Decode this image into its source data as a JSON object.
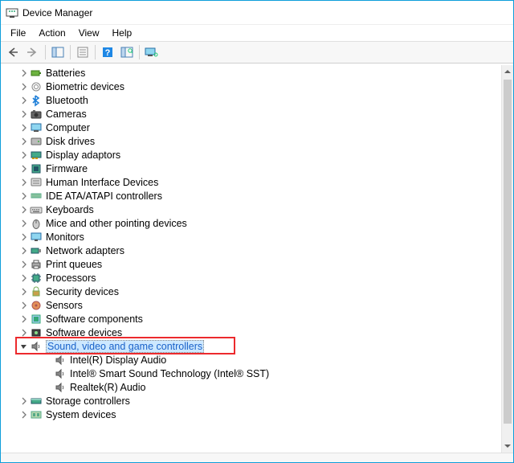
{
  "window": {
    "title": "Device Manager"
  },
  "menu": {
    "items": [
      "File",
      "Action",
      "View",
      "Help"
    ]
  },
  "toolbar": {
    "back_icon": "back-arrow-icon",
    "forward_icon": "forward-arrow-icon",
    "show_hide_icon": "show-hide-console-tree-icon",
    "properties_icon": "properties-icon",
    "help_icon": "help-icon",
    "scan_icon": "scan-hardware-changes-icon",
    "monitor_icon": "add-legacy-hardware-icon"
  },
  "tree": {
    "nodes": [
      {
        "label": "Batteries",
        "icon": "battery-icon",
        "expanded": false
      },
      {
        "label": "Biometric devices",
        "icon": "biometric-icon",
        "expanded": false
      },
      {
        "label": "Bluetooth",
        "icon": "bluetooth-icon",
        "expanded": false
      },
      {
        "label": "Cameras",
        "icon": "camera-icon",
        "expanded": false
      },
      {
        "label": "Computer",
        "icon": "computer-icon",
        "expanded": false
      },
      {
        "label": "Disk drives",
        "icon": "disk-drive-icon",
        "expanded": false
      },
      {
        "label": "Display adaptors",
        "icon": "display-adapter-icon",
        "expanded": false
      },
      {
        "label": "Firmware",
        "icon": "firmware-icon",
        "expanded": false
      },
      {
        "label": "Human Interface Devices",
        "icon": "hid-icon",
        "expanded": false
      },
      {
        "label": "IDE ATA/ATAPI controllers",
        "icon": "ide-controller-icon",
        "expanded": false
      },
      {
        "label": "Keyboards",
        "icon": "keyboard-icon",
        "expanded": false
      },
      {
        "label": "Mice and other pointing devices",
        "icon": "mouse-icon",
        "expanded": false
      },
      {
        "label": "Monitors",
        "icon": "monitor-icon",
        "expanded": false
      },
      {
        "label": "Network adapters",
        "icon": "network-adapter-icon",
        "expanded": false
      },
      {
        "label": "Print queues",
        "icon": "printer-icon",
        "expanded": false
      },
      {
        "label": "Processors",
        "icon": "processor-icon",
        "expanded": false
      },
      {
        "label": "Security devices",
        "icon": "security-device-icon",
        "expanded": false
      },
      {
        "label": "Sensors",
        "icon": "sensor-icon",
        "expanded": false
      },
      {
        "label": "Software components",
        "icon": "software-component-icon",
        "expanded": false
      },
      {
        "label": "Software devices",
        "icon": "software-device-icon",
        "expanded": false
      },
      {
        "label": "Sound, video and game controllers",
        "icon": "sound-controller-icon",
        "expanded": true,
        "selected": true,
        "highlighted": true,
        "children": [
          {
            "label": "Intel(R) Display Audio",
            "icon": "speaker-icon"
          },
          {
            "label": "Intel® Smart Sound Technology (Intel® SST)",
            "icon": "speaker-icon"
          },
          {
            "label": "Realtek(R) Audio",
            "icon": "speaker-icon"
          }
        ]
      },
      {
        "label": "Storage controllers",
        "icon": "storage-controller-icon",
        "expanded": false
      },
      {
        "label": "System devices",
        "icon": "system-device-icon",
        "expanded": false
      }
    ]
  }
}
